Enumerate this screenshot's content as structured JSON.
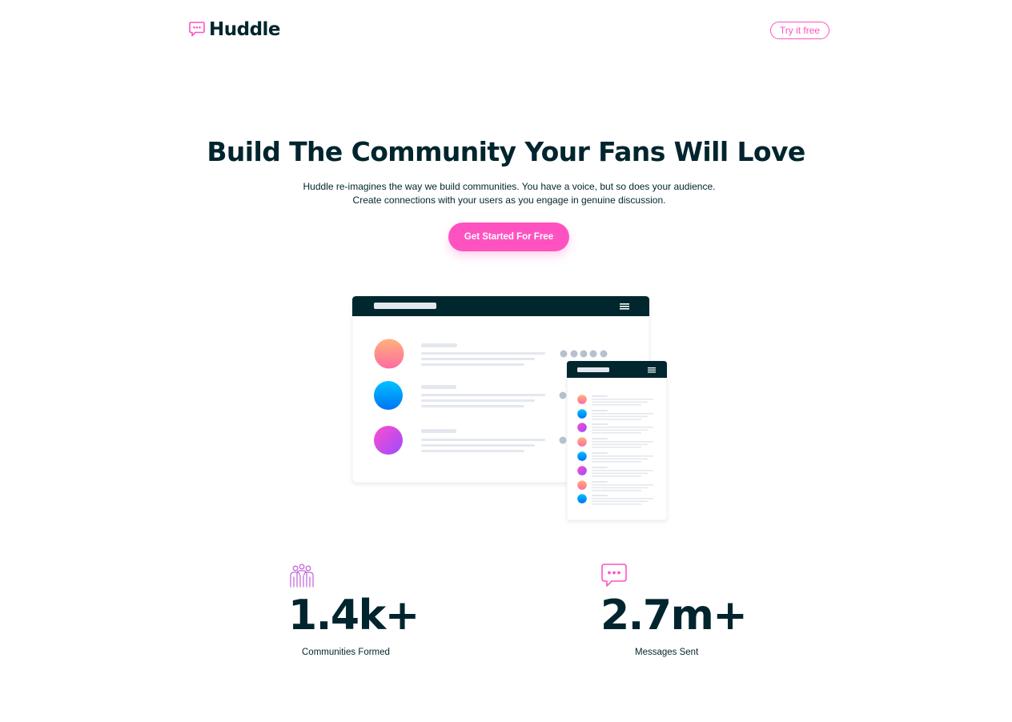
{
  "header": {
    "logo_text": "Huddle",
    "try_button_label": "Try it free"
  },
  "hero": {
    "title": "Build The Community Your Fans Will Love",
    "description": "Huddle re-imagines the way we build communities. You have a voice, but so does your audience. Create connections with your users as you engage in genuine discussion.",
    "cta_label": "Get Started For Free"
  },
  "stats": [
    {
      "value": "1.4k+",
      "label": "Communities Formed",
      "icon": "communities-icon"
    },
    {
      "value": "2.7m+",
      "label": "Messages Sent",
      "icon": "messages-icon"
    }
  ],
  "colors": {
    "brand_pink": "#ff52c1",
    "dark_cyan": "#00252e",
    "mockup_placeholder": "#e4e8ee",
    "mockup_dot": "#b6c0cf"
  },
  "mockup_avatars": [
    "orange-pink",
    "blue",
    "purple"
  ]
}
